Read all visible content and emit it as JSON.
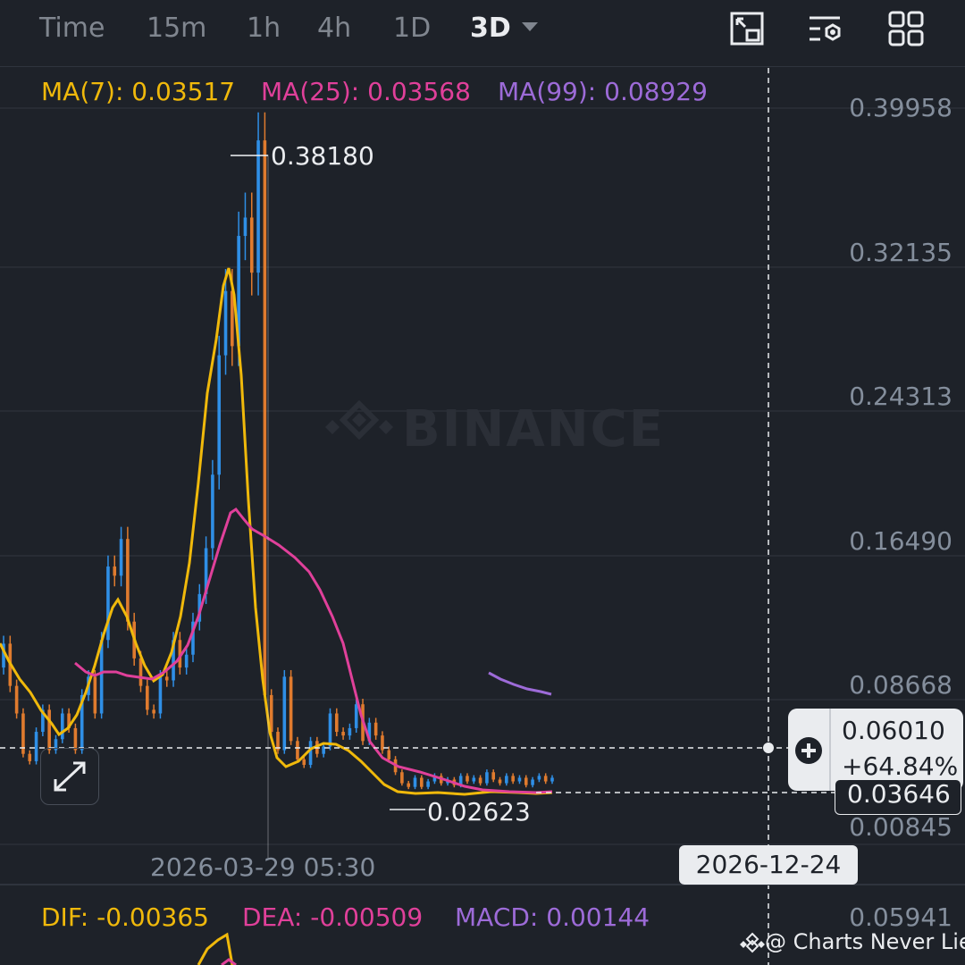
{
  "timeframes": {
    "items": [
      "Time",
      "15m",
      "1h",
      "4h",
      "1D",
      "3D"
    ],
    "active": "3D"
  },
  "toolbar": {
    "icons": [
      "fullscreen-icon",
      "indicator-settings-icon",
      "layout-grid-icon"
    ]
  },
  "ma": {
    "ma7": "MA(7): 0.03517",
    "ma25": "MA(25): 0.03568",
    "ma99": "MA(99): 0.08929"
  },
  "y_axis": [
    "0.39958",
    "0.32135",
    "0.24313",
    "0.16490",
    "0.08668",
    "0.00845"
  ],
  "annotations": {
    "high": "0.38180",
    "low": "0.02623"
  },
  "crosshair": {
    "price": "0.06010",
    "change": "+64.84%",
    "date": "2026-12-24"
  },
  "current_price": "0.03646",
  "cross_date": "2026-03-29 05:30",
  "macd": {
    "dif": "DIF: -0.00365",
    "dea": "DEA: -0.00509",
    "macd": "MACD: 0.00144",
    "axis_value": "0.05941"
  },
  "watermark": {
    "brand": "BINANCE",
    "credit": "@ Charts Never Lie"
  },
  "colors": {
    "up": "#2f8fe6",
    "down": "#e07b2e",
    "ma7": "#f0b90b",
    "ma25": "#e0409a",
    "ma99": "#9d6bd8",
    "background": "#1e2229"
  },
  "chart_data": {
    "type": "candlestick",
    "ylim": [
      0.00845,
      0.39958
    ],
    "high_marker": 0.3818,
    "low_marker": 0.02623,
    "candles_oc": [
      [
        0.095,
        0.108
      ],
      [
        0.108,
        0.085
      ],
      [
        0.085,
        0.07
      ],
      [
        0.07,
        0.048
      ],
      [
        0.048,
        0.044
      ],
      [
        0.044,
        0.06
      ],
      [
        0.06,
        0.072
      ],
      [
        0.072,
        0.05
      ],
      [
        0.05,
        0.056
      ],
      [
        0.056,
        0.07
      ],
      [
        0.07,
        0.062
      ],
      [
        0.062,
        0.05
      ],
      [
        0.05,
        0.08
      ],
      [
        0.08,
        0.09
      ],
      [
        0.09,
        0.07
      ],
      [
        0.07,
        0.11
      ],
      [
        0.11,
        0.15
      ],
      [
        0.15,
        0.145
      ],
      [
        0.145,
        0.165
      ],
      [
        0.165,
        0.12
      ],
      [
        0.12,
        0.1
      ],
      [
        0.1,
        0.085
      ],
      [
        0.085,
        0.072
      ],
      [
        0.072,
        0.07
      ],
      [
        0.07,
        0.09
      ],
      [
        0.09,
        0.088
      ],
      [
        0.088,
        0.11
      ],
      [
        0.11,
        0.095
      ],
      [
        0.095,
        0.102
      ],
      [
        0.102,
        0.12
      ],
      [
        0.12,
        0.135
      ],
      [
        0.135,
        0.16
      ],
      [
        0.16,
        0.2
      ],
      [
        0.2,
        0.265
      ],
      [
        0.265,
        0.3
      ],
      [
        0.3,
        0.27
      ],
      [
        0.27,
        0.33
      ],
      [
        0.33,
        0.34
      ],
      [
        0.34,
        0.31
      ],
      [
        0.31,
        0.382
      ],
      [
        0.382,
        0.08
      ],
      [
        0.08,
        0.06
      ],
      [
        0.06,
        0.05
      ],
      [
        0.05,
        0.09
      ],
      [
        0.09,
        0.055
      ],
      [
        0.055,
        0.045
      ],
      [
        0.045,
        0.042
      ],
      [
        0.042,
        0.055
      ],
      [
        0.055,
        0.048
      ],
      [
        0.048,
        0.052
      ],
      [
        0.052,
        0.07
      ],
      [
        0.07,
        0.06
      ],
      [
        0.06,
        0.058
      ],
      [
        0.058,
        0.062
      ],
      [
        0.062,
        0.075
      ],
      [
        0.075,
        0.055
      ],
      [
        0.055,
        0.065
      ],
      [
        0.065,
        0.058
      ],
      [
        0.058,
        0.05
      ],
      [
        0.05,
        0.045
      ],
      [
        0.045,
        0.038
      ],
      [
        0.038,
        0.032
      ],
      [
        0.032,
        0.03
      ],
      [
        0.03,
        0.035
      ],
      [
        0.035,
        0.03
      ],
      [
        0.03,
        0.033
      ],
      [
        0.033,
        0.036
      ],
      [
        0.036,
        0.032
      ],
      [
        0.032,
        0.034
      ],
      [
        0.034,
        0.031
      ],
      [
        0.031,
        0.036
      ],
      [
        0.036,
        0.033
      ],
      [
        0.033,
        0.035
      ],
      [
        0.035,
        0.032
      ],
      [
        0.032,
        0.038
      ],
      [
        0.038,
        0.034
      ],
      [
        0.034,
        0.032
      ],
      [
        0.032,
        0.036
      ],
      [
        0.036,
        0.033
      ],
      [
        0.033,
        0.035
      ],
      [
        0.035,
        0.031
      ],
      [
        0.031,
        0.034
      ],
      [
        0.034,
        0.036
      ],
      [
        0.036,
        0.033
      ],
      [
        0.033,
        0.035
      ]
    ],
    "ma7": [
      0.098,
      0.09,
      0.078,
      0.066,
      0.058,
      0.054,
      0.056,
      0.06,
      0.07,
      0.088,
      0.108,
      0.125,
      0.131,
      0.12,
      0.104,
      0.094,
      0.09,
      0.1,
      0.12,
      0.15,
      0.19,
      0.235,
      0.27,
      0.3,
      0.292,
      0.22,
      0.15,
      0.09,
      0.062,
      0.052,
      0.056,
      0.06,
      0.062,
      0.06,
      0.058,
      0.055,
      0.05,
      0.045,
      0.04,
      0.037,
      0.035,
      0.034,
      0.034,
      0.034,
      0.033,
      0.034,
      0.035,
      0.035,
      0.035,
      0.035
    ],
    "ma25_label_value": 0.03568,
    "ma99_label_value": 0.08929
  }
}
